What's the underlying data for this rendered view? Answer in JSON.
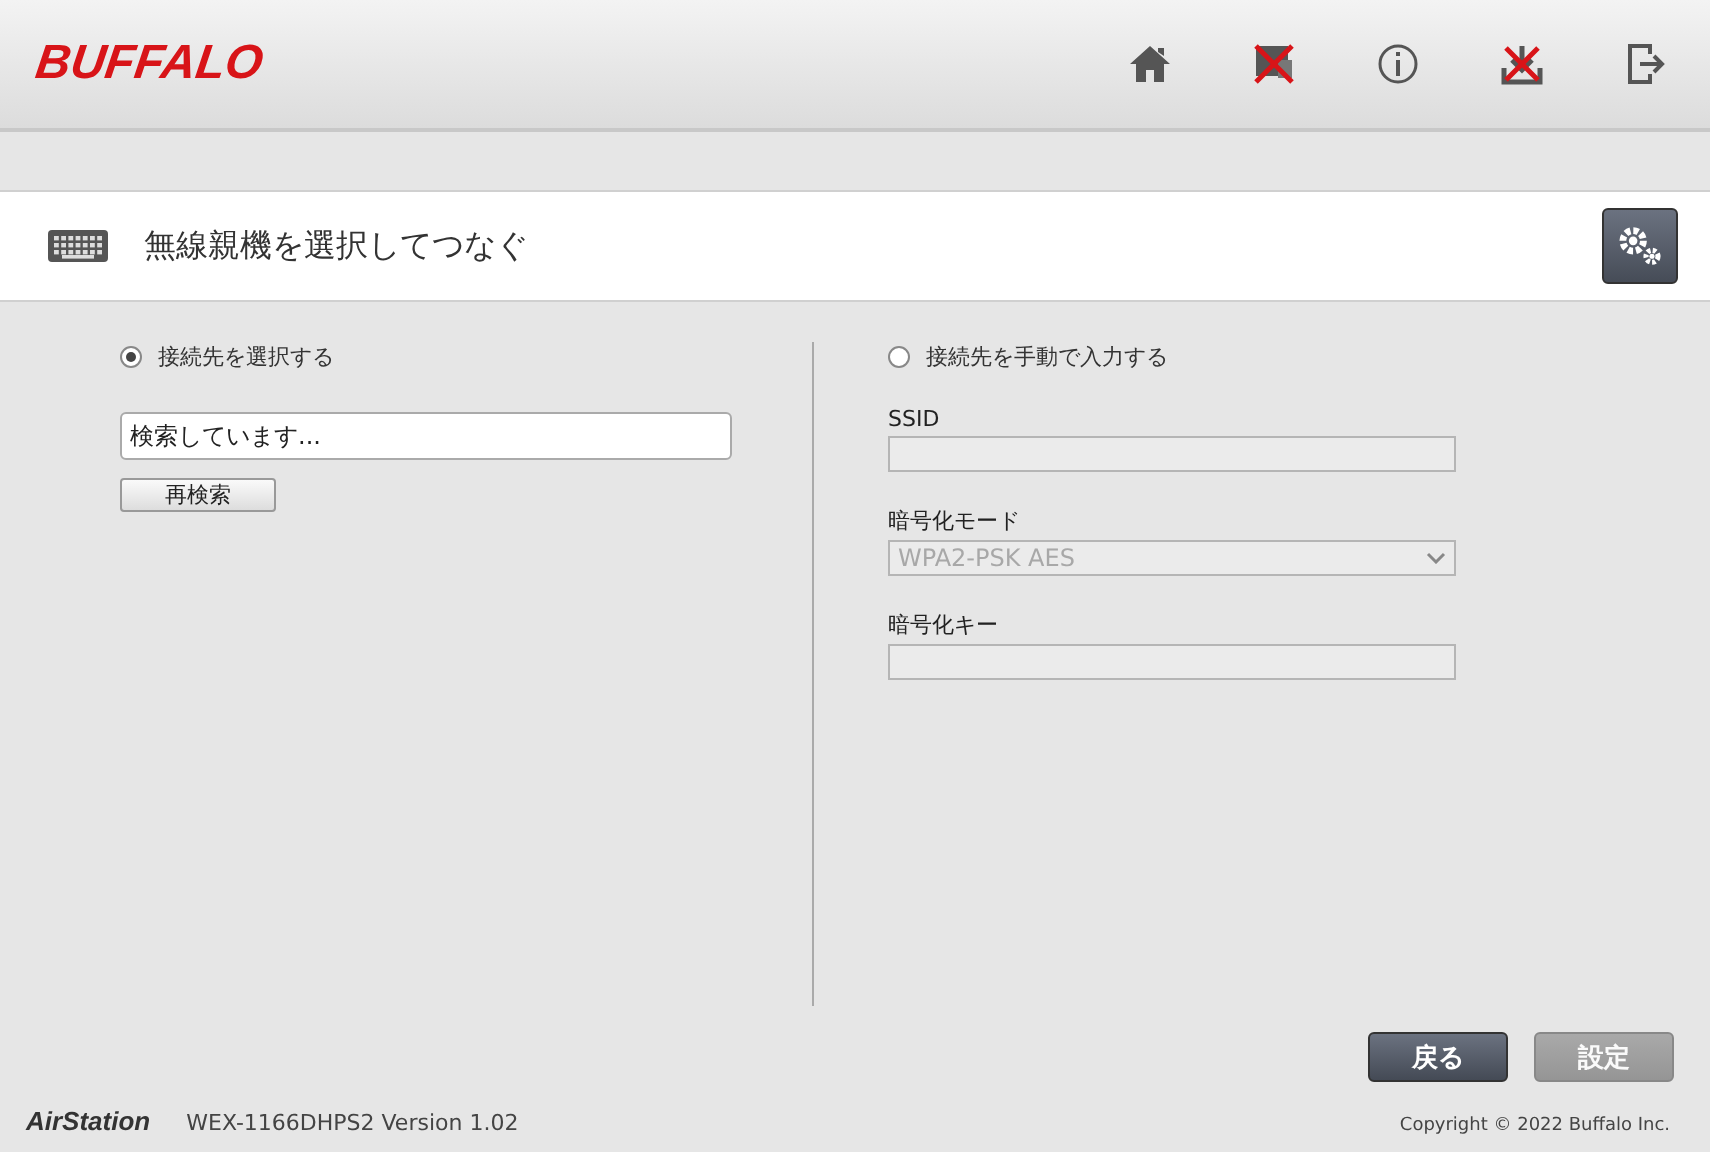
{
  "header": {
    "logo": "BUFFALO"
  },
  "page": {
    "title": "無線親機を選択してつなぐ"
  },
  "select_option": {
    "label": "接続先を選択する",
    "selected": true,
    "search_box": {
      "value": "検索しています..."
    },
    "rescan_button": "再検索"
  },
  "manual_option": {
    "label": "接続先を手動で入力する",
    "selected": false,
    "fields": [
      {
        "kind": "text",
        "label": "SSID",
        "disabled": true
      },
      {
        "kind": "select",
        "label": "暗号化モード",
        "value": "WPA2-PSK AES",
        "disabled": true
      },
      {
        "kind": "text",
        "label": "暗号化キー",
        "disabled": true
      }
    ]
  },
  "buttons": [
    {
      "label": "戻る",
      "disabled": false
    },
    {
      "label": "設定",
      "disabled": true
    }
  ],
  "footer": {
    "brand": "AirStation",
    "version": "WEX-1166DHPS2 Version 1.02",
    "copyright": "Copyright © 2022 Buffalo Inc."
  }
}
